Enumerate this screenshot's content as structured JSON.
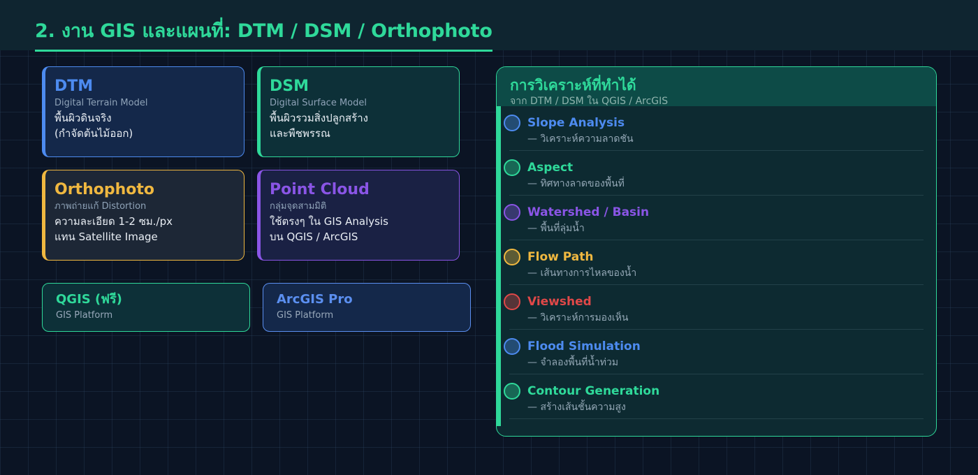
{
  "header": {
    "title": "2. งาน GIS และแผนที่: DTM / DSM / Orthophoto"
  },
  "cards": [
    {
      "title": "DTM",
      "subtitle": "Digital Terrain Model",
      "desc1": "พื้นผิวดินจริง",
      "desc2": "(กำจัดต้นไม้ออก)",
      "color": "#4d8bf0",
      "bg": "#14284a"
    },
    {
      "title": "DSM",
      "subtitle": "Digital Surface Model",
      "desc1": "พื้นผิวรวมสิ่งปลูกสร้าง",
      "desc2": "และพืชพรรณ",
      "color": "#2fd99a",
      "bg": "#0d3038"
    },
    {
      "title": "Orthophoto",
      "subtitle": "ภาพถ่ายแก้ Distortion",
      "desc1": "ความละเอียด 1-2 ซม./px",
      "desc2": "แทน Satellite Image",
      "color": "#f0b840",
      "bg": "#1d2736"
    },
    {
      "title": "Point Cloud",
      "subtitle": "กลุ่มจุดสามมิติ",
      "desc1": "ใช้ตรงๆ ใน GIS Analysis",
      "desc2": "บน QGIS / ArcGIS",
      "color": "#8a55e6",
      "bg": "#1a2144"
    }
  ],
  "software": [
    {
      "name": "QGIS (ฟรี)",
      "type": "GIS Platform",
      "color": "#2fd99a",
      "bg": "#0d3038"
    },
    {
      "name": "ArcGIS Pro",
      "type": "GIS Platform",
      "color": "#5b8ff0",
      "bg": "#14284a"
    }
  ],
  "analysis": {
    "title": "การวิเคราะห์ที่ทำได้",
    "subtitle": "จาก DTM / DSM ใน QGIS / ArcGIS",
    "items": [
      {
        "name": "Slope Analysis",
        "desc": "— วิเคราะห์ความลาดชัน",
        "color": "#4d8bf0"
      },
      {
        "name": "Aspect",
        "desc": "— ทิศทางลาดของพื้นที่",
        "color": "#2fd99a"
      },
      {
        "name": "Watershed / Basin",
        "desc": "— พื้นที่ลุ่มน้ำ",
        "color": "#8a55e6"
      },
      {
        "name": "Flow Path",
        "desc": "— เส้นทางการไหลของน้ำ",
        "color": "#f0b840"
      },
      {
        "name": "Viewshed",
        "desc": "— วิเคราะห์การมองเห็น",
        "color": "#e04848"
      },
      {
        "name": "Flood Simulation",
        "desc": "— จำลองพื้นที่น้ำท่วม",
        "color": "#4d8bf0"
      },
      {
        "name": "Contour Generation",
        "desc": "— สร้างเส้นชั้นความสูง",
        "color": "#2fd99a"
      }
    ]
  }
}
